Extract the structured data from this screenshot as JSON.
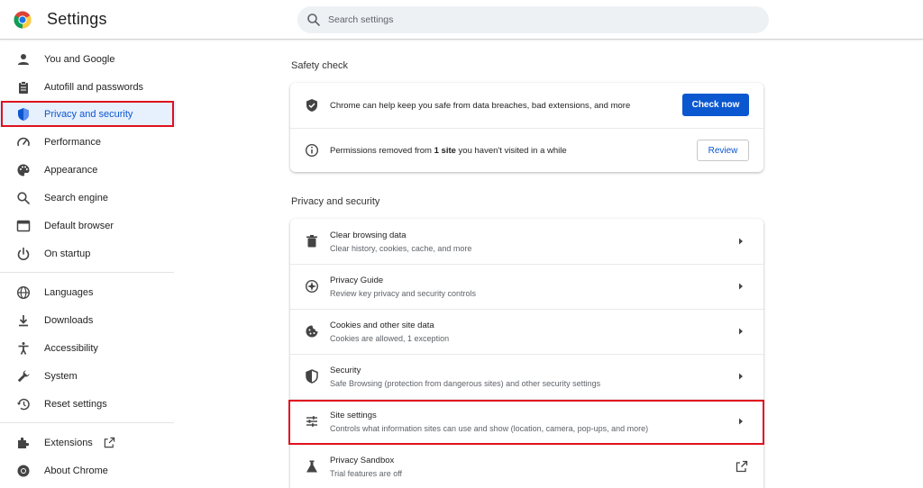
{
  "header": {
    "title": "Settings",
    "search_placeholder": "Search settings"
  },
  "sidebar": {
    "items": [
      {
        "label": "You and Google",
        "icon": "person-icon"
      },
      {
        "label": "Autofill and passwords",
        "icon": "clipboard-icon"
      },
      {
        "label": "Privacy and security",
        "icon": "shield-icon",
        "active": true
      },
      {
        "label": "Performance",
        "icon": "speedometer-icon"
      },
      {
        "label": "Appearance",
        "icon": "palette-icon"
      },
      {
        "label": "Search engine",
        "icon": "search-icon"
      },
      {
        "label": "Default browser",
        "icon": "browser-icon"
      },
      {
        "label": "On startup",
        "icon": "power-icon"
      },
      {
        "label": "Languages",
        "icon": "globe-icon"
      },
      {
        "label": "Downloads",
        "icon": "download-icon"
      },
      {
        "label": "Accessibility",
        "icon": "accessibility-icon"
      },
      {
        "label": "System",
        "icon": "wrench-icon"
      },
      {
        "label": "Reset settings",
        "icon": "history-icon"
      },
      {
        "label": "Extensions",
        "icon": "puzzle-icon"
      },
      {
        "label": "About Chrome",
        "icon": "chrome-icon"
      }
    ]
  },
  "safety_check": {
    "title": "Safety check",
    "row1_text": "Chrome can help keep you safe from data breaches, bad extensions, and more",
    "check_button": "Check now",
    "row2_pre": "Permissions removed from ",
    "row2_bold": "1 site",
    "row2_post": " you haven't visited in a while",
    "review_button": "Review"
  },
  "privacy": {
    "title": "Privacy and security",
    "rows": [
      {
        "title": "Clear browsing data",
        "subtitle": "Clear history, cookies, cache, and more",
        "icon": "trash-icon"
      },
      {
        "title": "Privacy Guide",
        "subtitle": "Review key privacy and security controls",
        "icon": "compass-icon"
      },
      {
        "title": "Cookies and other site data",
        "subtitle": "Cookies are allowed, 1 exception",
        "icon": "cookie-icon"
      },
      {
        "title": "Security",
        "subtitle": "Safe Browsing (protection from dangerous sites) and other security settings",
        "icon": "shield-icon"
      },
      {
        "title": "Site settings",
        "subtitle": "Controls what information sites can use and show (location, camera, pop-ups, and more)",
        "icon": "sliders-icon"
      },
      {
        "title": "Privacy Sandbox",
        "subtitle": "Trial features are off",
        "icon": "flask-icon"
      }
    ]
  },
  "colors": {
    "accent": "#0b57d0",
    "active_bg": "#e7f0fd",
    "highlight": "#e0101e"
  }
}
